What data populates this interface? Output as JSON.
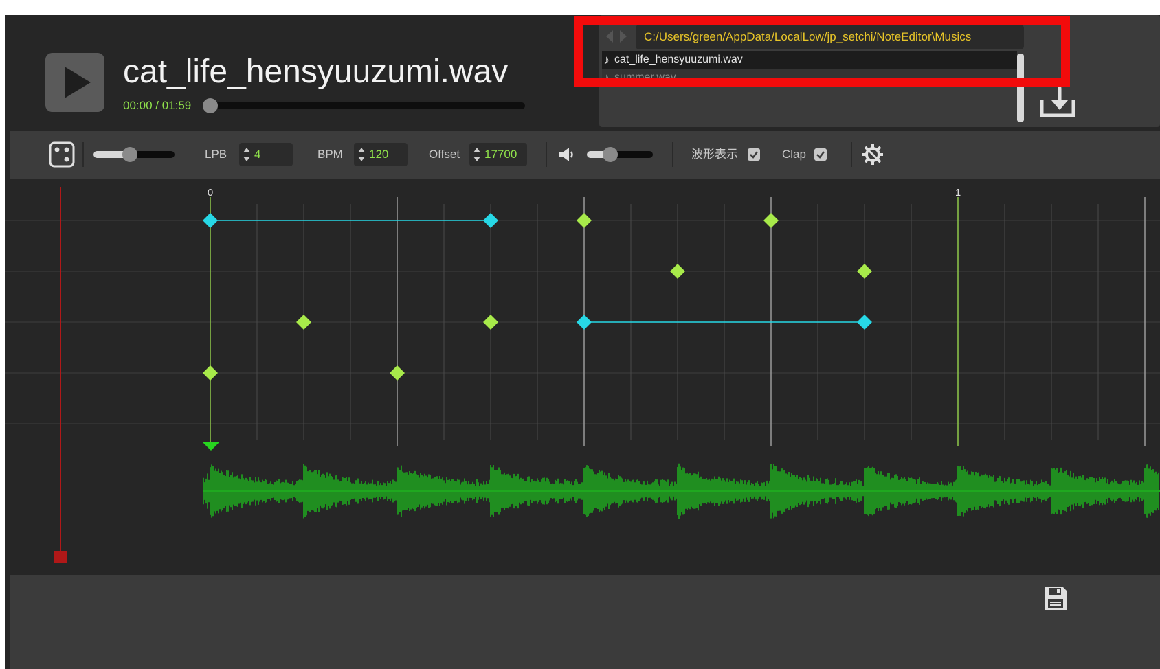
{
  "header": {
    "title": "cat_life_hensyuuzumi.wav",
    "time": "00:00 / 01:59",
    "seek_progress": 0.0
  },
  "browser": {
    "path": "C:/Users/green/AppData/LocalLow/jp_setchi/NoteEditor\\Musics",
    "files": [
      {
        "name": "cat_life_hensyuuzumi.wav",
        "selected": true
      },
      {
        "name": "summer.wav",
        "selected": false
      }
    ]
  },
  "toolbar": {
    "lpb_label": "LPB",
    "lpb_value": "4",
    "bpm_label": "BPM",
    "bpm_value": "120",
    "offset_label": "Offset",
    "offset_value": "17700",
    "waveform_label": "波形表示",
    "waveform_checked": true,
    "clap_label": "Clap",
    "clap_checked": true,
    "zoom_level": 0.45,
    "volume_level": 0.35
  },
  "editor": {
    "measure_labels": [
      "0",
      "1"
    ],
    "lines": 5,
    "beats_per_measure": 16,
    "notes": [
      {
        "beat": 0,
        "lane": 0,
        "type": "long"
      },
      {
        "beat": 6,
        "lane": 0,
        "type": "long"
      },
      {
        "beat": 8,
        "lane": 0,
        "type": "single"
      },
      {
        "beat": 12,
        "lane": 0,
        "type": "single"
      },
      {
        "beat": 10,
        "lane": 1,
        "type": "single"
      },
      {
        "beat": 14,
        "lane": 1,
        "type": "single"
      },
      {
        "beat": 2,
        "lane": 2,
        "type": "single"
      },
      {
        "beat": 6,
        "lane": 2,
        "type": "single"
      },
      {
        "beat": 8,
        "lane": 2,
        "type": "long"
      },
      {
        "beat": 14,
        "lane": 2,
        "type": "long"
      },
      {
        "beat": 0,
        "lane": 3,
        "type": "single"
      },
      {
        "beat": 4,
        "lane": 3,
        "type": "single"
      }
    ],
    "long_links": [
      {
        "from_beat": 0,
        "to_beat": 6,
        "lane": 0
      },
      {
        "from_beat": 8,
        "to_beat": 14,
        "lane": 2
      }
    ]
  },
  "colors": {
    "accent_green": "#8fe14a",
    "path_yellow": "#e8c528",
    "long_note": "#27d8e6",
    "single_note": "#a8ea4a",
    "waveform": "#1fa81f",
    "playhead": "#b01818",
    "highlight": "#f20b0b"
  },
  "icons": {
    "play": "play-icon",
    "dice": "dice-icon",
    "speaker": "speaker-icon",
    "settings": "gear-icon",
    "import": "import-icon",
    "save": "save-icon"
  }
}
